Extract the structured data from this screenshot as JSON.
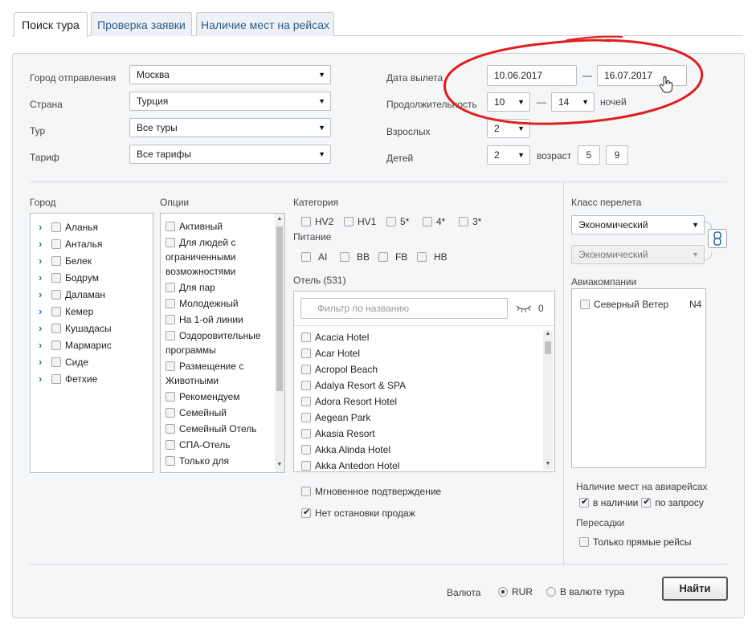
{
  "tabs": [
    {
      "label": "Поиск тура",
      "active": true
    },
    {
      "label": "Проверка заявки",
      "active": false
    },
    {
      "label": "Наличие мест на рейсах",
      "active": false
    }
  ],
  "form": {
    "departure_city": {
      "label": "Город отправления",
      "value": "Москва"
    },
    "country": {
      "label": "Страна",
      "value": "Турция"
    },
    "tour": {
      "label": "Тур",
      "value": "Все туры"
    },
    "tariff": {
      "label": "Тариф",
      "value": "Все тарифы"
    },
    "departure_date": {
      "label": "Дата вылета",
      "from": "10.06.2017",
      "dash": "—",
      "to": "16.07.2017"
    },
    "duration": {
      "label": "Продолжительность",
      "from": "10",
      "dash": "—",
      "to": "14",
      "unit": "ночей"
    },
    "adults": {
      "label": "Взрослых",
      "value": "2"
    },
    "children": {
      "label": "Детей",
      "value": "2",
      "age_label": "возраст",
      "ages": [
        "5",
        "9"
      ]
    }
  },
  "city": {
    "label": "Город",
    "items": [
      "Аланья",
      "Анталья",
      "Белек",
      "Бодрум",
      "Даламан",
      "Кемер",
      "Кушадасы",
      "Мармарис",
      "Сиде",
      "Фетхие"
    ]
  },
  "options": {
    "label": "Опции",
    "items": [
      "Активный",
      "Для людей с ограниченными возможностями",
      "Для пар",
      "Молодежный",
      "На 1-ой линии",
      "Оздоровительные программы",
      "Размещение с Животными",
      "Рекомендуем",
      "Семейный",
      "Семейный Отель",
      "СПА-Отель",
      "Только для"
    ]
  },
  "category": {
    "label": "Категория",
    "items": [
      "HV2",
      "HV1",
      "5*",
      "4*",
      "3*"
    ]
  },
  "meal": {
    "label": "Питание",
    "items": [
      "AI",
      "BB",
      "FB",
      "HB"
    ]
  },
  "hotels": {
    "label": "Отель (531)",
    "filter_placeholder": "Фильтр по названию",
    "selected_count": "0",
    "items": [
      "Acacia Hotel",
      "Acar Hotel",
      "Acropol Beach",
      "Adalya Resort & SPA",
      "Adora Resort Hotel",
      "Aegean Park",
      "Akasia Resort",
      "Akka Alinda Hotel",
      "Akka Antedon Hotel"
    ]
  },
  "instant_confirmation": {
    "label": "Мгновенное подтверждение",
    "checked": false
  },
  "no_stop_sale": {
    "label": "Нет остановки продаж",
    "checked": true
  },
  "flight_class": {
    "label": "Класс перелета",
    "value": "Экономический",
    "return_value": "Экономический"
  },
  "airlines": {
    "label": "Авиакомпании",
    "items": [
      {
        "name": "Северный Ветер",
        "code": "N4"
      }
    ]
  },
  "seats": {
    "label": "Наличие мест на авиарейсах",
    "available": "в наличии",
    "on_request": "по запросу"
  },
  "transfers": {
    "label": "Пересадки",
    "direct_only": "Только прямые рейсы"
  },
  "currency": {
    "label": "Валюта",
    "rur": "RUR",
    "tour_currency": "В валюте тура"
  },
  "search_button": "Найти",
  "colors": {
    "annotation_red": "#e01e1e",
    "link_blue": "#2b77c7"
  }
}
